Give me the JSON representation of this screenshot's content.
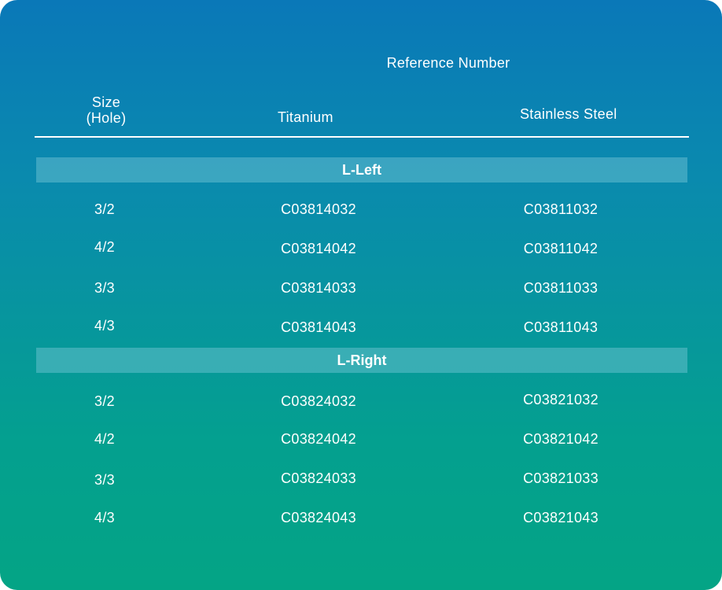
{
  "header": {
    "reference_number": "Reference Number",
    "size_line1": "Size",
    "size_line2": "(Hole)",
    "titanium": "Titanium",
    "stainless_steel": "Stainless Steel"
  },
  "groups": [
    {
      "label": "L-Left",
      "rows": [
        {
          "size": "3/2",
          "titanium": "C03814032",
          "stainless": "C03811032"
        },
        {
          "size": "4/2",
          "titanium": "C03814042",
          "stainless": "C03811042"
        },
        {
          "size": "3/3",
          "titanium": "C03814033",
          "stainless": "C03811033"
        },
        {
          "size": "4/3",
          "titanium": "C03814043",
          "stainless": "C03811043"
        }
      ]
    },
    {
      "label": "L-Right",
      "rows": [
        {
          "size": "3/2",
          "titanium": "C03824032",
          "stainless": "C03821032"
        },
        {
          "size": "4/2",
          "titanium": "C03824042",
          "stainless": "C03821042"
        },
        {
          "size": "3/3",
          "titanium": "C03824033",
          "stainless": "C03821033"
        },
        {
          "size": "4/3",
          "titanium": "C03824043",
          "stainless": "C03821043"
        }
      ]
    }
  ]
}
